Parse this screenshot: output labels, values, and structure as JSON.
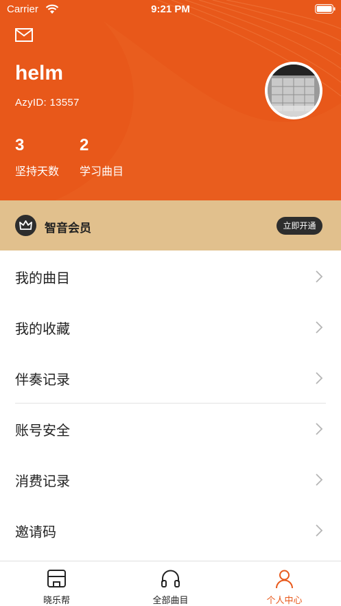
{
  "status_bar": {
    "carrier": "Carrier",
    "time": "9:21 PM"
  },
  "profile": {
    "username": "helm",
    "user_id": "AzyID: 13557",
    "stats": [
      {
        "value": "3",
        "label": "坚持天数"
      },
      {
        "value": "2",
        "label": "学习曲目"
      }
    ]
  },
  "vip": {
    "label": "智音会员",
    "button": "立即开通"
  },
  "menu": {
    "items": [
      {
        "label": "我的曲目"
      },
      {
        "label": "我的收藏"
      },
      {
        "label": "伴奏记录"
      },
      {
        "label": "账号安全"
      },
      {
        "label": "消费记录"
      },
      {
        "label": "邀请码"
      }
    ]
  },
  "tabbar": {
    "tabs": [
      {
        "label": "晓乐帮",
        "icon": "store-icon"
      },
      {
        "label": "全部曲目",
        "icon": "headphones-icon"
      },
      {
        "label": "个人中心",
        "icon": "person-icon",
        "active": true
      }
    ]
  },
  "colors": {
    "accent": "#e8581a",
    "vip_bg": "#e1c08d",
    "dark": "#2d2d2d"
  }
}
